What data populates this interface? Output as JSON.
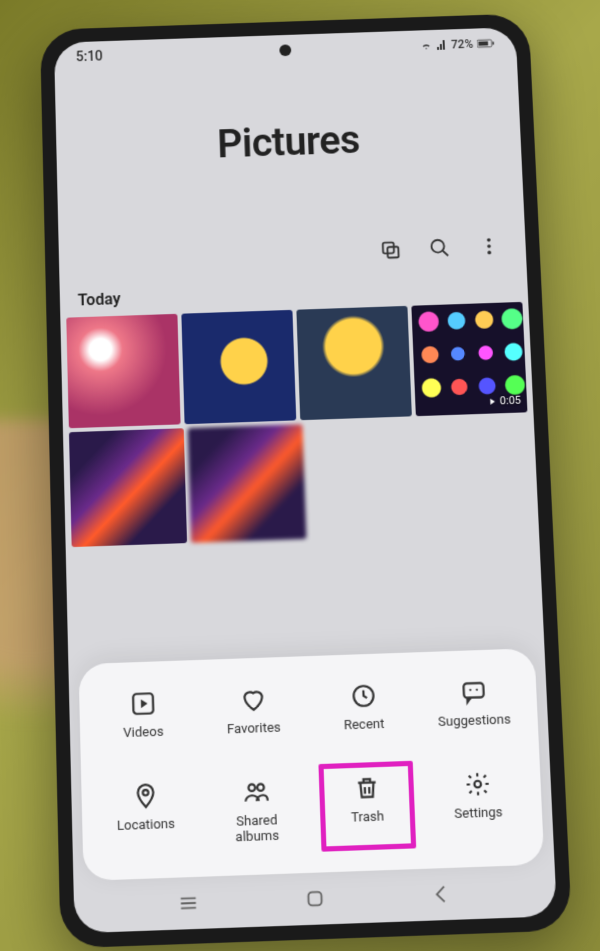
{
  "statusbar": {
    "time": "5:10",
    "battery": "72%"
  },
  "header": {
    "title": "Pictures"
  },
  "toolbar": {
    "sync_icon": "sync",
    "search_icon": "search",
    "more_icon": "more"
  },
  "section": {
    "today_label": "Today",
    "video_duration": "0:05"
  },
  "sheet": {
    "items": [
      {
        "id": "videos",
        "label": "Videos",
        "icon": "play-square"
      },
      {
        "id": "favorites",
        "label": "Favorites",
        "icon": "heart"
      },
      {
        "id": "recent",
        "label": "Recent",
        "icon": "clock"
      },
      {
        "id": "suggestions",
        "label": "Suggestions",
        "icon": "message"
      },
      {
        "id": "locations",
        "label": "Locations",
        "icon": "pin"
      },
      {
        "id": "sharedalbums",
        "label": "Shared\nalbums",
        "icon": "people"
      },
      {
        "id": "trash",
        "label": "Trash",
        "icon": "trash",
        "highlighted": true
      },
      {
        "id": "settings",
        "label": "Settings",
        "icon": "gear"
      }
    ]
  }
}
